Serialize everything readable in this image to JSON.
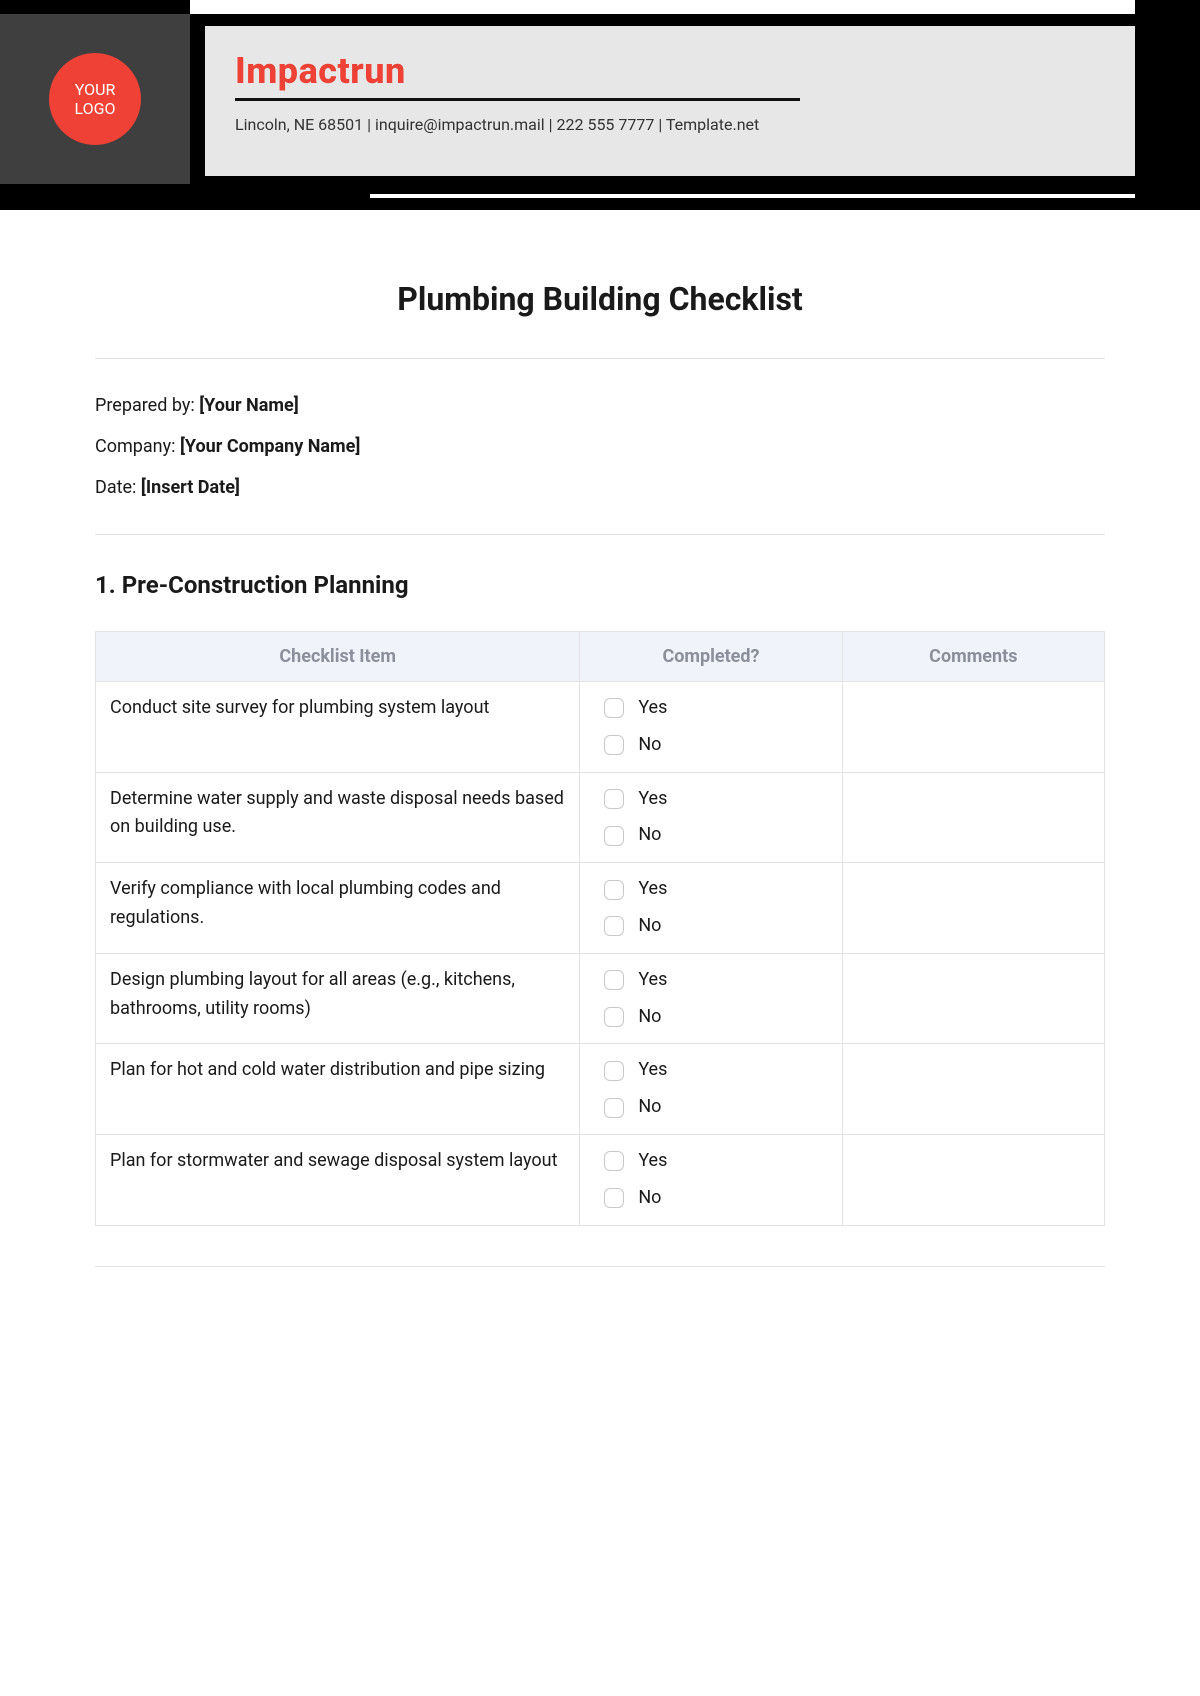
{
  "header": {
    "logo_line1": "YOUR",
    "logo_line2": "LOGO",
    "company_name": "Impactrun",
    "company_info": "Lincoln, NE 68501 | inquire@impactrun.mail | 222 555 7777 | Template.net"
  },
  "doc_title": "Plumbing Building Checklist",
  "meta": {
    "prepared_label": "Prepared by: ",
    "prepared_value": "[Your Name]",
    "company_label": "Company: ",
    "company_value": "[Your Company Name]",
    "date_label": "Date: ",
    "date_value": "[Insert Date]"
  },
  "section1": {
    "title": "1. Pre-Construction Planning",
    "columns": {
      "item": "Checklist Item",
      "completed": "Completed?",
      "comments": "Comments"
    },
    "yes_label": "Yes",
    "no_label": "No",
    "rows": [
      {
        "item": "Conduct site survey for plumbing system layout",
        "comments": ""
      },
      {
        "item": "Determine water supply and waste disposal needs based on building use.",
        "comments": ""
      },
      {
        "item": "Verify compliance with local plumbing codes and regulations.",
        "comments": ""
      },
      {
        "item": "Design plumbing layout for all areas (e.g., kitchens, bathrooms, utility rooms)",
        "comments": ""
      },
      {
        "item": "Plan for hot and cold water distribution and pipe sizing",
        "comments": ""
      },
      {
        "item": "Plan for stormwater and sewage disposal system layout",
        "comments": ""
      }
    ]
  }
}
